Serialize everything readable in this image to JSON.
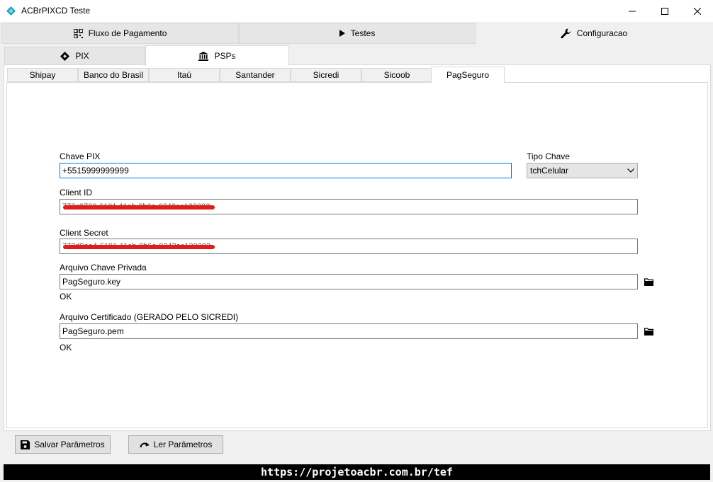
{
  "window": {
    "title": "ACBrPIXCD Teste",
    "icon": "diamond-logo-icon",
    "accent_color": "#17a2b8"
  },
  "main_tabs": [
    {
      "label": "Fluxo de Pagamento",
      "icon": "qr-code-icon"
    },
    {
      "label": "Testes",
      "icon": "play-icon"
    },
    {
      "label": "Configuracao",
      "icon": "wrench-icon",
      "active": true
    }
  ],
  "config_tabs": [
    {
      "label": "PIX",
      "icon": "pix-diamond-icon"
    },
    {
      "label": "PSPs",
      "icon": "bank-icon",
      "active": true
    }
  ],
  "psp_tabs": [
    {
      "label": "Shipay"
    },
    {
      "label": "Banco do Brasil"
    },
    {
      "label": "Itaú"
    },
    {
      "label": "Santander"
    },
    {
      "label": "Sicredi"
    },
    {
      "label": "Sicoob"
    },
    {
      "label": "PagSeguro",
      "active": true
    }
  ],
  "form": {
    "chave_pix": {
      "label": "Chave PIX",
      "value": "+5515999999999"
    },
    "tipo_chave": {
      "label": "Tipo Chave",
      "value": "tchCelular"
    },
    "client_id": {
      "label": "Client ID",
      "value": "773c8730-6191-11eb-9b6a-0242ac130002",
      "redacted": true
    },
    "client_secret": {
      "label": "Client Secret",
      "value": "773d9aa4-6191-11eb-9b6a-0242ac130002",
      "redacted": true
    },
    "arquivo_chave": {
      "label": "Arquivo Chave Privada",
      "value": "PagSeguro.key",
      "status": "OK"
    },
    "arquivo_cert": {
      "label": "Arquivo Certificado (GERADO PELO SICREDI)",
      "value": "PagSeguro.pem",
      "status": "OK"
    }
  },
  "buttons": {
    "salvar": "Salvar Parâmetros",
    "ler": "Ler Parâmetros"
  },
  "footer": {
    "url": "https://projetoacbr.com.br/tef"
  },
  "colors": {
    "redaction": "#e31b1b",
    "focus_border": "#0078d7"
  }
}
